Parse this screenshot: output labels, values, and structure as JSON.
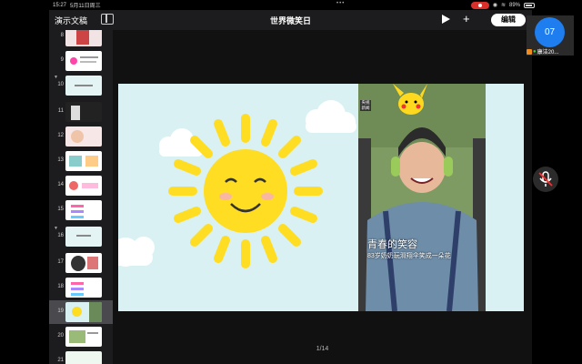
{
  "status_bar": {
    "time": "15:27",
    "date": "5月11日周三",
    "battery": "89%"
  },
  "toolbar": {
    "back_label": "演示文稿",
    "title": "世界微笑日",
    "edit_label": "编辑"
  },
  "sidebar": {
    "slides": [
      {
        "number": "8",
        "collapsed": false
      },
      {
        "number": "9",
        "collapsed": false
      },
      {
        "number": "10",
        "collapsed": true
      },
      {
        "number": "11",
        "collapsed": false
      },
      {
        "number": "12",
        "collapsed": false
      },
      {
        "number": "13",
        "collapsed": false
      },
      {
        "number": "14",
        "collapsed": false
      },
      {
        "number": "15",
        "collapsed": false
      },
      {
        "number": "16",
        "collapsed": true
      },
      {
        "number": "17",
        "collapsed": false
      },
      {
        "number": "18",
        "collapsed": false
      },
      {
        "number": "19",
        "collapsed": false,
        "selected": true
      },
      {
        "number": "20",
        "collapsed": false
      },
      {
        "number": "21",
        "collapsed": false
      }
    ]
  },
  "slide": {
    "photo_caption_title": "青春的笑容",
    "photo_caption_sub": "83岁奶奶玩滑翔伞笑成一朵花",
    "photo_logo": "央视新闻"
  },
  "slide_counter": "1/14",
  "participant": {
    "avatar_text": "07",
    "name": "康洁20..."
  },
  "colors": {
    "edit_button_bg": "#ffffff",
    "avatar_bg": "#1e7ef0",
    "slide_bg": "#daf1f3",
    "sun_yellow": "#ffdd22",
    "record_red": "#d9302c"
  },
  "icons": {
    "play": "play-icon",
    "add": "plus-icon",
    "sidebar_toggle": "sidebar-icon",
    "microphone": "mic-muted-icon"
  }
}
